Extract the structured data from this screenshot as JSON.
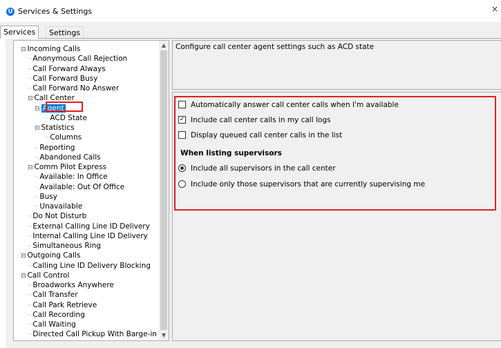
{
  "window": {
    "title": "Services & Settings",
    "app_icon_glyph": "U",
    "close_glyph": "×"
  },
  "tabs": [
    {
      "label": "Services"
    },
    {
      "label": "Settings"
    }
  ],
  "tree": {
    "items": [
      {
        "label": "Incoming Calls",
        "expander": "⊟"
      },
      {
        "label": "Anonymous Call Rejection"
      },
      {
        "label": "Call Forward Always"
      },
      {
        "label": "Call Forward Busy"
      },
      {
        "label": "Call Forward No Answer"
      },
      {
        "label": "Call Center",
        "expander": "⊟"
      },
      {
        "label": "Agent",
        "expander": "⊟",
        "selected": true
      },
      {
        "label": "ACD State"
      },
      {
        "label": "Statistics",
        "expander": "⊟"
      },
      {
        "label": "Columns"
      },
      {
        "label": "Reporting"
      },
      {
        "label": "Abandoned Calls"
      },
      {
        "label": "Comm Pilot Express",
        "expander": "⊟"
      },
      {
        "label": "Available: In Office"
      },
      {
        "label": "Available: Out Of Office"
      },
      {
        "label": "Busy"
      },
      {
        "label": "Unavailable"
      },
      {
        "label": "Do Not Disturb"
      },
      {
        "label": "External Calling Line ID Delivery"
      },
      {
        "label": "Internal Calling Line ID Delivery"
      },
      {
        "label": "Simultaneous Ring"
      },
      {
        "label": "Outgoing Calls",
        "expander": "⊟"
      },
      {
        "label": "Calling Line ID Delivery Blocking"
      },
      {
        "label": "Call Control",
        "expander": "⊟"
      },
      {
        "label": "Broadworks Anywhere"
      },
      {
        "label": "Call Transfer"
      },
      {
        "label": "Call Park Retrieve"
      },
      {
        "label": "Call Recording"
      },
      {
        "label": "Call Waiting"
      },
      {
        "label": "Directed Call Pickup With Barge-in"
      }
    ],
    "scroll_up_glyph": "▲",
    "scroll_down_glyph": "▼"
  },
  "description": {
    "text": "Configure call center agent settings such as ACD state"
  },
  "settings": {
    "checkboxes": [
      {
        "label": "Automatically answer call center calls when I'm available",
        "checked": false
      },
      {
        "label": "Include call center calls in my call logs",
        "checked": true
      },
      {
        "label": "Display queued call center calls in the list",
        "checked": false
      }
    ],
    "supervisors_heading": "When listing supervisors",
    "radios": [
      {
        "label": "Include all supervisors in the call center",
        "selected": true
      },
      {
        "label": "Include only those supervisors that are currently supervising me",
        "selected": false
      }
    ]
  },
  "colors": {
    "highlight": "#e02020",
    "selection": "#0078d7",
    "app_icon": "#1a73e8"
  }
}
